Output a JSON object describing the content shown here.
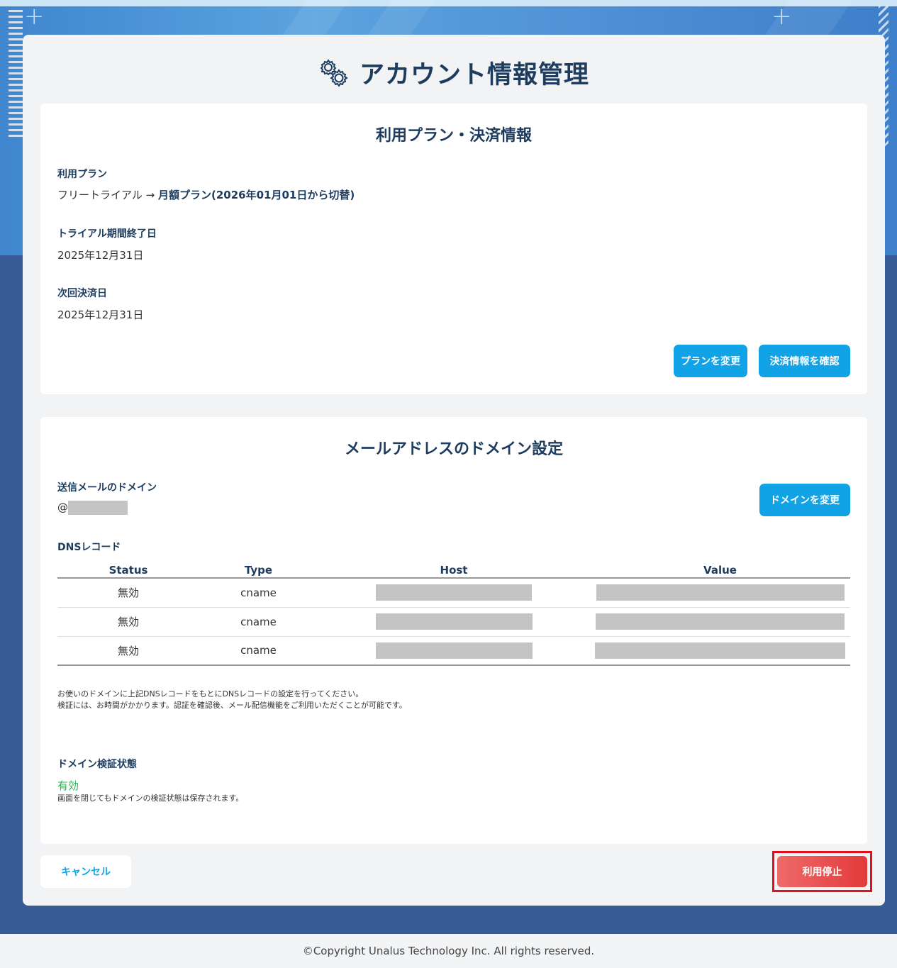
{
  "page": {
    "title": "アカウント情報管理",
    "footer": "©Copyright Unalus Technology Inc. All rights reserved."
  },
  "plan_section": {
    "title": "利用プラン・決済情報",
    "plan_label": "利用プラン",
    "plan_current": "フリートライアル →",
    "plan_next": "月額プラン(2026年01月01日から切替)",
    "trial_end_label": "トライアル期間終了日",
    "trial_end_value": "2025年12月31日",
    "next_payment_label": "次回決済日",
    "next_payment_value": "2025年12月31日",
    "change_plan_button": "プランを変更",
    "payment_info_button": "決済情報を確認"
  },
  "domain_section": {
    "title": "メールアドレスのドメイン設定",
    "sender_domain_label": "送信メールのドメイン",
    "sender_domain_prefix": "@",
    "change_domain_button": "ドメインを変更",
    "dns_label": "DNSレコード",
    "dns_columns": [
      "Status",
      "Type",
      "Host",
      "Value"
    ],
    "dns_rows": [
      {
        "status": "無効",
        "type": "cname"
      },
      {
        "status": "無効",
        "type": "cname"
      },
      {
        "status": "無効",
        "type": "cname"
      }
    ],
    "note_line1": "お使いのドメインに上記DNSレコードをもとにDNSレコードの設定を行ってください。",
    "note_line2": "検証には、お時間がかかります。認証を確認後、メール配信機能をご利用いただくことが可能です。",
    "verify_label": "ドメイン検証状態",
    "verify_value": "有効",
    "verify_note": "画面を閉じてもドメインの検証状態は保存されます。"
  },
  "actions": {
    "cancel_button": "キャンセル",
    "stop_button": "利用停止"
  },
  "colors": {
    "accent": "#12a3e6",
    "heading": "#1e3c5e",
    "danger": "#e33a3a",
    "valid": "#2fb45a"
  }
}
